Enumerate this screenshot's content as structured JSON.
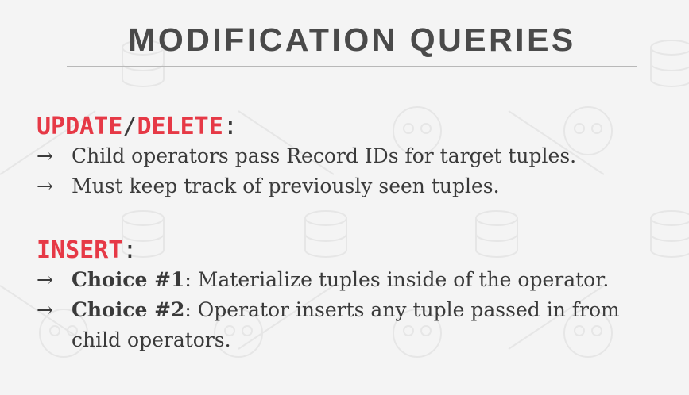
{
  "slide": {
    "title": "MODIFICATION QUERIES"
  },
  "sections": [
    {
      "kw1": "UPDATE",
      "sep": "/",
      "kw2": "DELETE",
      "colon": ":",
      "bullets": [
        "Child operators pass Record IDs for target tuples.",
        "Must keep track of previously seen tuples."
      ]
    },
    {
      "kw1": "INSERT",
      "colon": ":",
      "bullets": [
        {
          "bold": "Choice #1",
          "rest": ": Materialize tuples inside of the operator."
        },
        {
          "bold": "Choice #2",
          "rest": ": Operator inserts any tuple passed in from",
          "rest2": "child operators."
        }
      ]
    }
  ],
  "arrow_glyph": "→"
}
